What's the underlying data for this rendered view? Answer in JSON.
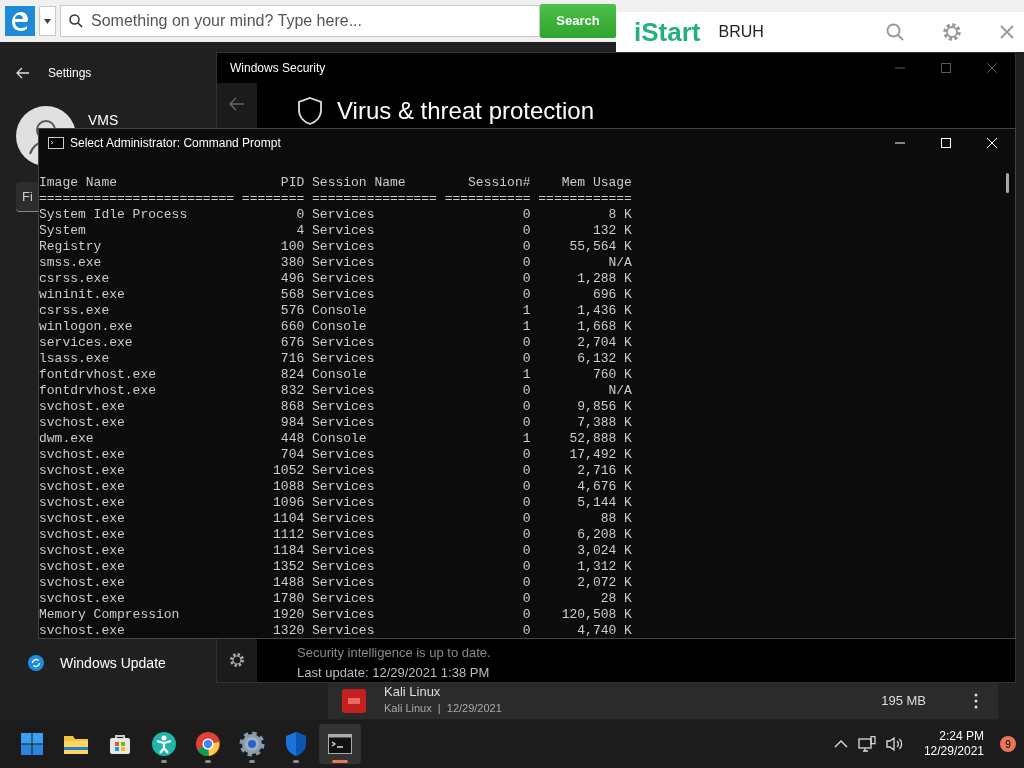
{
  "browser_toolbar": {
    "search": {
      "placeholder": "Something on your mind? Type here..."
    },
    "search_button": "Search",
    "brand": "iStart",
    "profile": "BRUH"
  },
  "settings_window": {
    "title": "Settings",
    "user": "VMS",
    "search": {
      "value": "Fi"
    },
    "nav_items": [
      {
        "label": "Windows Update"
      }
    ]
  },
  "security_window": {
    "title": "Windows Security",
    "heading": "Virus & threat protection",
    "status": "Security intelligence is up to date.",
    "last_update": "Last update: 12/29/2021 1:38 PM"
  },
  "app_row": {
    "name": "Kali Linux",
    "meta": "Kali Linux  |  12/29/2021",
    "size": "195 MB"
  },
  "command_prompt": {
    "title": "Select Administrator: Command Prompt",
    "columns": [
      "Image Name",
      "PID",
      "Session Name",
      "Session#",
      "Mem Usage"
    ],
    "rule": "========================= ======== ================ =========== ============",
    "rows": [
      [
        "System Idle Process",
        "0",
        "Services",
        "0",
        "8 K"
      ],
      [
        "System",
        "4",
        "Services",
        "0",
        "132 K"
      ],
      [
        "Registry",
        "100",
        "Services",
        "0",
        "55,564 K"
      ],
      [
        "smss.exe",
        "380",
        "Services",
        "0",
        "N/A"
      ],
      [
        "csrss.exe",
        "496",
        "Services",
        "0",
        "1,288 K"
      ],
      [
        "wininit.exe",
        "568",
        "Services",
        "0",
        "696 K"
      ],
      [
        "csrss.exe",
        "576",
        "Console",
        "1",
        "1,436 K"
      ],
      [
        "winlogon.exe",
        "660",
        "Console",
        "1",
        "1,668 K"
      ],
      [
        "services.exe",
        "676",
        "Services",
        "0",
        "2,704 K"
      ],
      [
        "lsass.exe",
        "716",
        "Services",
        "0",
        "6,132 K"
      ],
      [
        "fontdrvhost.exe",
        "824",
        "Console",
        "1",
        "760 K"
      ],
      [
        "fontdrvhost.exe",
        "832",
        "Services",
        "0",
        "N/A"
      ],
      [
        "svchost.exe",
        "868",
        "Services",
        "0",
        "9,856 K"
      ],
      [
        "svchost.exe",
        "984",
        "Services",
        "0",
        "7,388 K"
      ],
      [
        "dwm.exe",
        "448",
        "Console",
        "1",
        "52,888 K"
      ],
      [
        "svchost.exe",
        "704",
        "Services",
        "0",
        "17,492 K"
      ],
      [
        "svchost.exe",
        "1052",
        "Services",
        "0",
        "2,716 K"
      ],
      [
        "svchost.exe",
        "1088",
        "Services",
        "0",
        "4,676 K"
      ],
      [
        "svchost.exe",
        "1096",
        "Services",
        "0",
        "5,144 K"
      ],
      [
        "svchost.exe",
        "1104",
        "Services",
        "0",
        "88 K"
      ],
      [
        "svchost.exe",
        "1112",
        "Services",
        "0",
        "6,208 K"
      ],
      [
        "svchost.exe",
        "1184",
        "Services",
        "0",
        "3,024 K"
      ],
      [
        "svchost.exe",
        "1352",
        "Services",
        "0",
        "1,312 K"
      ],
      [
        "svchost.exe",
        "1488",
        "Services",
        "0",
        "2,072 K"
      ],
      [
        "svchost.exe",
        "1780",
        "Services",
        "0",
        "28 K"
      ],
      [
        "Memory Compression",
        "1920",
        "Services",
        "0",
        "120,508 K"
      ],
      [
        "svchost.exe",
        "1320",
        "Services",
        "0",
        "4,740 K"
      ]
    ]
  },
  "taskbar": {
    "apps": [
      {
        "kind": "start",
        "running": false,
        "selected": false
      },
      {
        "kind": "folder",
        "running": false,
        "selected": false
      },
      {
        "kind": "store",
        "running": false,
        "selected": false
      },
      {
        "kind": "figure",
        "running": true,
        "selected": false
      },
      {
        "kind": "browser",
        "running": true,
        "selected": false
      },
      {
        "kind": "gear",
        "running": true,
        "selected": false
      },
      {
        "kind": "shield",
        "running": true,
        "selected": false
      },
      {
        "kind": "terminal",
        "running": true,
        "selected": true
      }
    ],
    "time": "2:24 PM",
    "date": "12/29/2021",
    "notifications": "9"
  }
}
